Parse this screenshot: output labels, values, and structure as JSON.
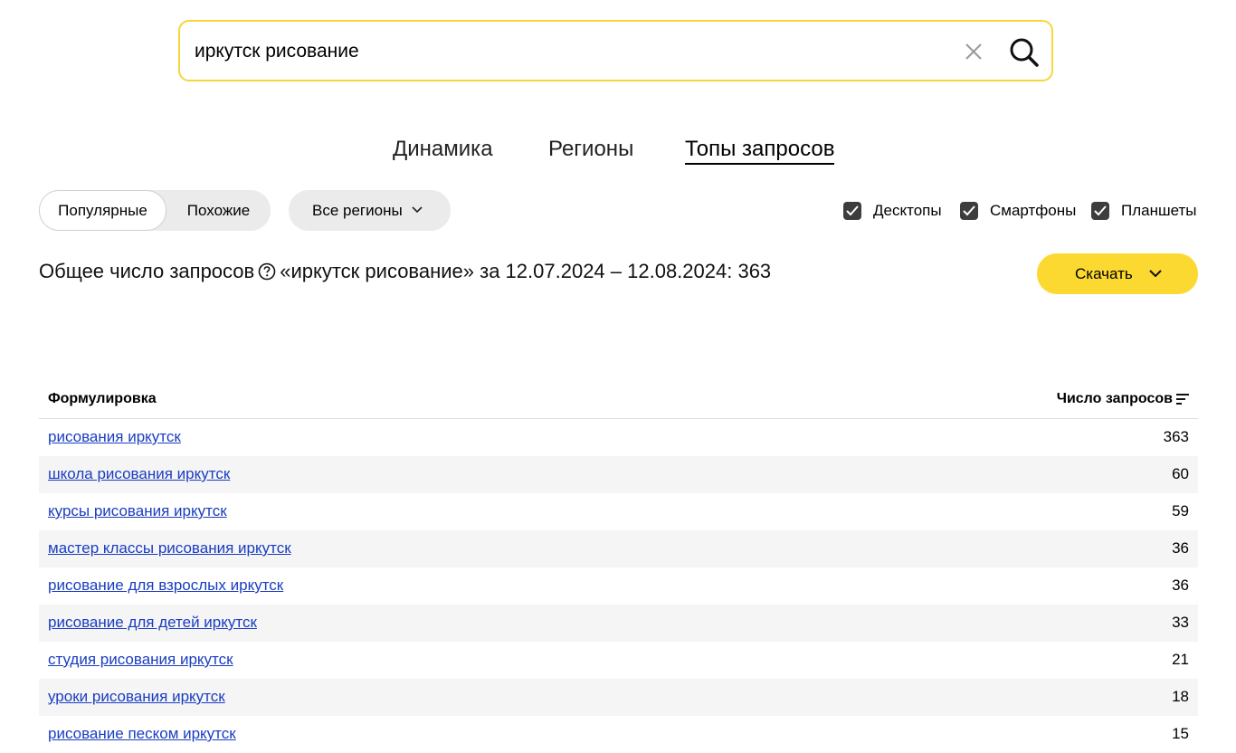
{
  "search": {
    "value": "иркутск рисование"
  },
  "tabs": [
    {
      "label": "Динамика"
    },
    {
      "label": "Регионы"
    },
    {
      "label": "Топы запросов",
      "active": true
    }
  ],
  "segment": {
    "active": "Популярные",
    "inactive": "Похожие"
  },
  "region": {
    "label": "Все регионы"
  },
  "devices": [
    {
      "label": "Десктопы",
      "checked": true
    },
    {
      "label": "Смартфоны",
      "checked": true
    },
    {
      "label": "Планшеты",
      "checked": true
    }
  ],
  "summary": {
    "prefix": "Общее число запросов",
    "suffix": "«иркутск рисование» за 12.07.2024 – 12.08.2024: 363"
  },
  "download": {
    "label": "Скачать"
  },
  "table": {
    "headers": {
      "phrase": "Формулировка",
      "count": "Число запросов"
    },
    "rows": [
      {
        "phrase": "рисования иркутск",
        "count": "363"
      },
      {
        "phrase": "школа рисования иркутск",
        "count": "60"
      },
      {
        "phrase": "курсы рисования иркутск",
        "count": "59"
      },
      {
        "phrase": "мастер классы рисования иркутск",
        "count": "36"
      },
      {
        "phrase": "рисование для взрослых иркутск",
        "count": "36"
      },
      {
        "phrase": "рисование для детей иркутск",
        "count": "33"
      },
      {
        "phrase": "студия рисования иркутск",
        "count": "21"
      },
      {
        "phrase": "уроки рисования иркутск",
        "count": "18"
      },
      {
        "phrase": "рисование песком иркутск",
        "count": "15"
      }
    ]
  },
  "colors": {
    "accent": "#fcd931",
    "search_border": "#f5d63b",
    "link": "#1a3dc1",
    "checkbox": "#3d3d3d"
  }
}
